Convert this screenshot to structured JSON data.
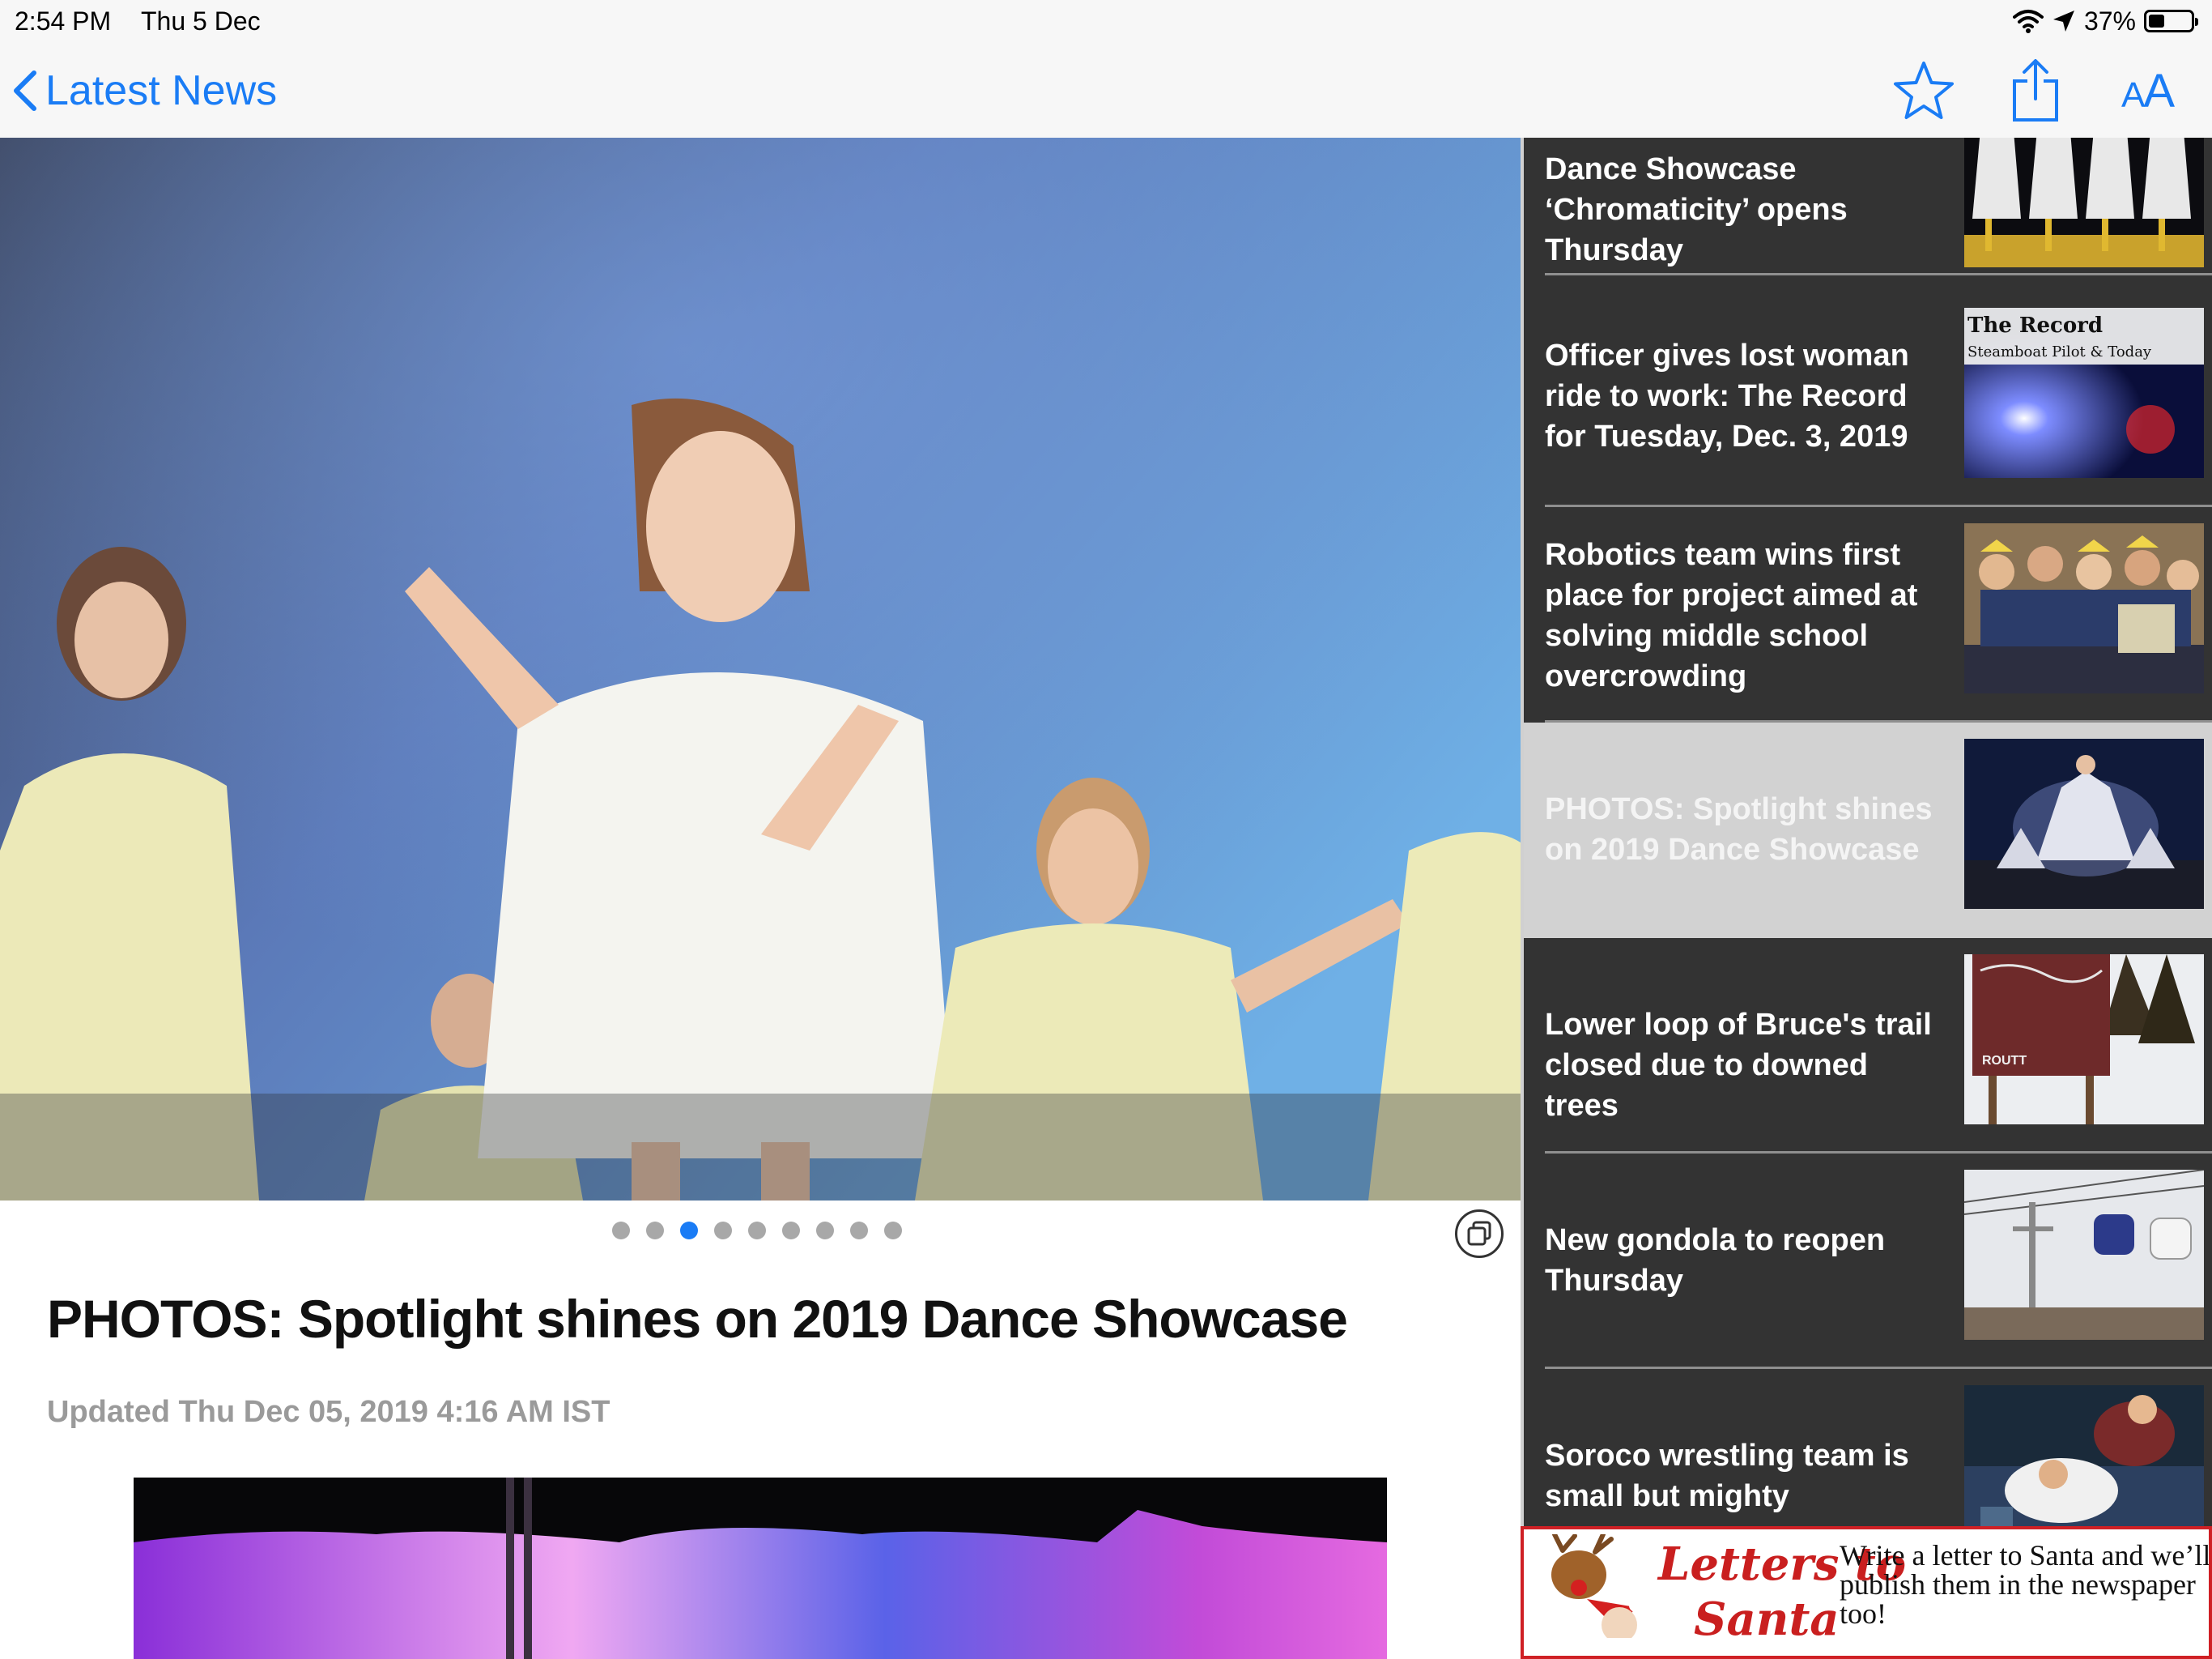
{
  "status_bar": {
    "time": "2:54 PM",
    "date": "Thu 5 Dec",
    "battery": "37%",
    "battery_level": 0.37
  },
  "nav": {
    "back_label": "Latest News",
    "icons": [
      "chevron-left-icon",
      "star-icon",
      "share-icon",
      "text-size-icon"
    ],
    "text_size_label": "AA",
    "accent_color": "#1a7cf5"
  },
  "article": {
    "title": "PHOTOS: Spotlight shines on 2019 Dance Showcase",
    "updated": "Updated Thu Dec 05, 2019 4:16 AM IST",
    "gallery": {
      "total": 9,
      "current_index": 3
    }
  },
  "sidebar": {
    "background_color": "#333333",
    "selected_color": "#d2d2d2",
    "stories": [
      {
        "title": "Dance Showcase ‘Chromaticity’ opens Thursday"
      },
      {
        "title": "Officer gives lost woman ride to work: The Record for Tuesday, Dec. 3, 2019",
        "thumb_line1": "The Record",
        "thumb_line2": "Steamboat Pilot & Today"
      },
      {
        "title": "Robotics team wins first place for project aimed at solving middle school overcrowding"
      },
      {
        "title": "PHOTOS: Spotlight shines on 2019 Dance Showcase",
        "selected": true
      },
      {
        "title": "Lower loop of Bruce's trail closed due to downed trees",
        "thumb_text": "ROUTT"
      },
      {
        "title": "New gondola to reopen Thursday"
      },
      {
        "title": "Soroco wrestling team is small but mighty"
      }
    ]
  },
  "ad": {
    "title_line1": "Letters to",
    "title_line2": "Santa",
    "body": "Write a letter to Santa and we’ll publish them in the newspaper too!",
    "border_color": "#cf2025"
  }
}
